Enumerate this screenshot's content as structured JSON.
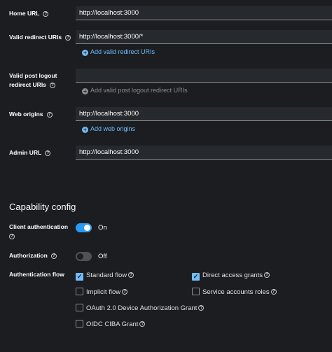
{
  "fields": {
    "home_url": {
      "label": "Home URL",
      "value": "http://localhost:3000"
    },
    "valid_redirect": {
      "label": "Valid redirect URIs",
      "value": "http://localhost:3000/*",
      "add": "Add valid redirect URIs"
    },
    "post_logout": {
      "label_line1": "Valid post logout",
      "label_line2": "redirect URIs",
      "value": "",
      "add": "Add valid post logout redirect URIs"
    },
    "web_origins": {
      "label": "Web origins",
      "value": "http://localhost:3000",
      "add": "Add web origins"
    },
    "admin_url": {
      "label": "Admin URL",
      "value": "http://localhost:3000"
    }
  },
  "capability": {
    "title": "Capability config",
    "client_auth": {
      "label": "Client authentication",
      "state": "On"
    },
    "authorization": {
      "label": "Authorization",
      "state": "Off"
    },
    "auth_flow": {
      "label": "Authentication flow",
      "options": {
        "standard": {
          "label": "Standard flow",
          "checked": true
        },
        "direct": {
          "label": "Direct access grants",
          "checked": true
        },
        "implicit": {
          "label": "Implicit flow",
          "checked": false
        },
        "service": {
          "label": "Service accounts roles",
          "checked": false
        },
        "oauth_device": {
          "label": "OAuth 2.0 Device Authorization Grant",
          "checked": false
        },
        "ciba": {
          "label": "OIDC CIBA Grant",
          "checked": false
        }
      }
    }
  },
  "icons": {
    "help": "?",
    "plus": "+",
    "check": "✓"
  }
}
